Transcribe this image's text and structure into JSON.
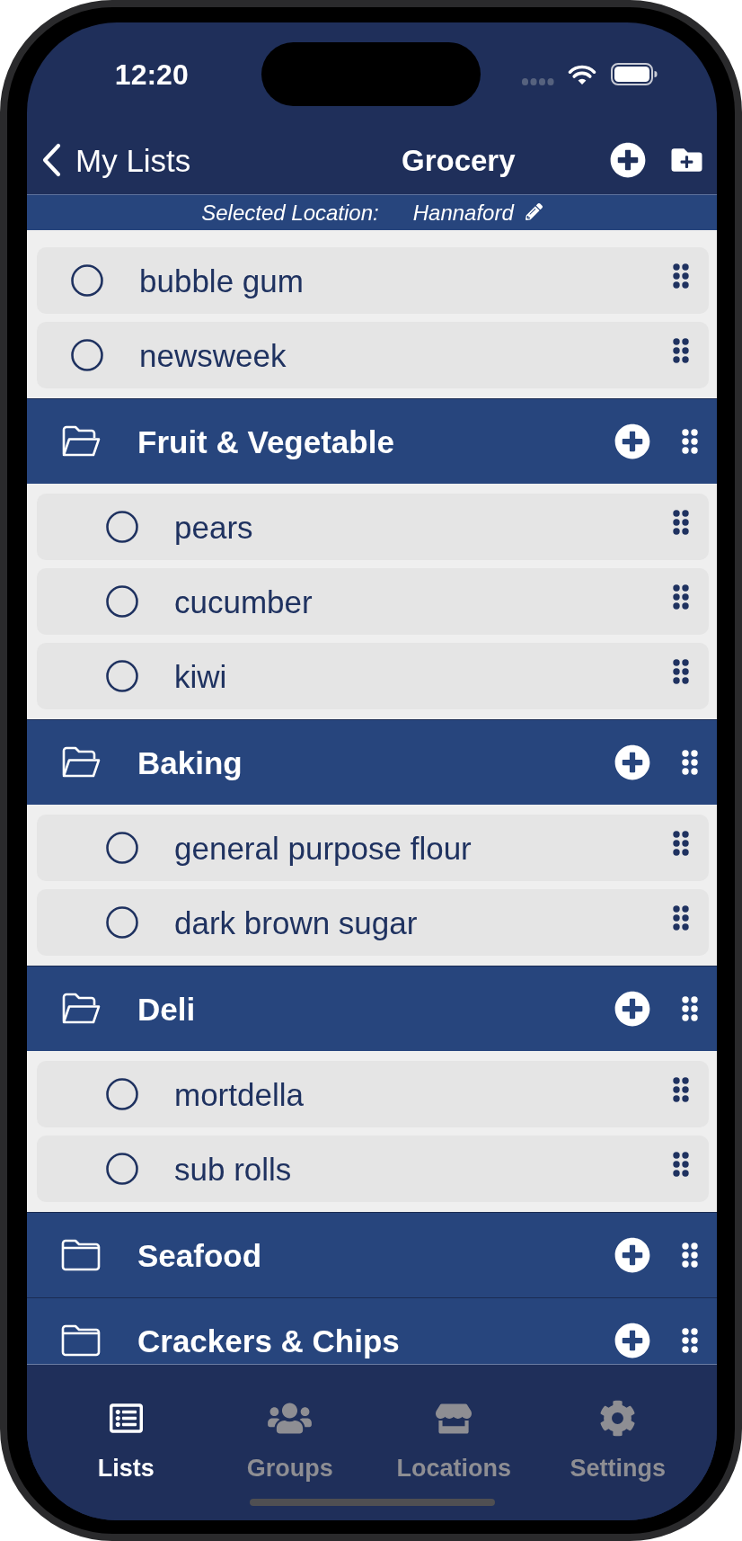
{
  "status_bar": {
    "time": "12:20"
  },
  "nav_bar": {
    "back_label": "My Lists",
    "title": "Grocery"
  },
  "location_bar": {
    "label": "Selected Location:",
    "value": "Hannaford"
  },
  "items": [
    {
      "name": "bubble gum",
      "checked": false
    },
    {
      "name": "newsweek",
      "checked": false
    }
  ],
  "categories": [
    {
      "name": "Fruit & Vegetable",
      "expanded": true,
      "items": [
        {
          "name": "pears",
          "checked": false
        },
        {
          "name": "cucumber",
          "checked": false
        },
        {
          "name": "kiwi",
          "checked": false
        }
      ]
    },
    {
      "name": "Baking",
      "expanded": true,
      "items": [
        {
          "name": "general purpose flour",
          "checked": false
        },
        {
          "name": "dark brown sugar",
          "checked": false
        }
      ]
    },
    {
      "name": "Deli",
      "expanded": true,
      "items": [
        {
          "name": "mortdella",
          "checked": false
        },
        {
          "name": "sub rolls",
          "checked": false
        }
      ]
    },
    {
      "name": "Seafood",
      "expanded": false
    },
    {
      "name": "Crackers & Chips",
      "expanded": false
    }
  ],
  "tab_bar": [
    {
      "label": "Lists",
      "selected": true
    },
    {
      "label": "Groups",
      "selected": false
    },
    {
      "label": "Locations",
      "selected": false
    },
    {
      "label": "Settings",
      "selected": false
    }
  ]
}
